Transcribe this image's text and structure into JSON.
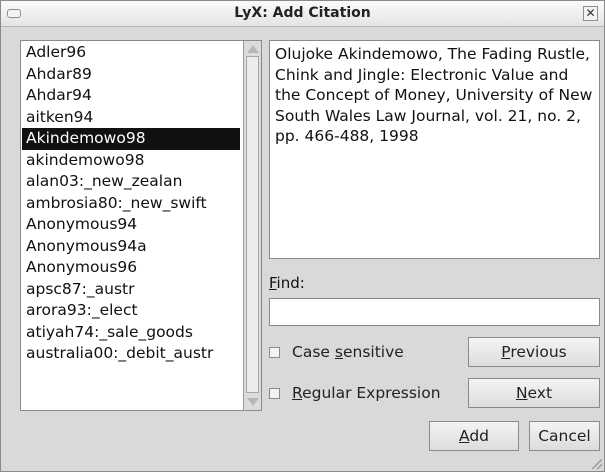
{
  "window": {
    "title": "LyX: Add Citation"
  },
  "keys": [
    "Adler96",
    "Ahdar89",
    "Ahdar94",
    "aitken94",
    "Akindemowo98",
    "akindemowo98",
    "alan03:_new_zealan",
    "ambrosia80:_new_swift",
    "Anonymous94",
    "Anonymous94a",
    "Anonymous96",
    "apsc87:_austr",
    "arora93:_elect",
    "atiyah74:_sale_goods",
    "australia00:_debit_austr"
  ],
  "selected_key": "Akindemowo98",
  "info_text": "Olujoke Akindemowo, The Fading Rustle, Chink and Jingle: Electronic Value and the Concept of Money, University of New South Wales Law Journal, vol. 21, no. 2, pp. 466-488, 1998",
  "find": {
    "label": "Find:",
    "value": ""
  },
  "options": {
    "case_sensitive": {
      "label": "Case sensitive",
      "checked": false
    },
    "regex": {
      "label": "Regular Expression",
      "checked": false
    }
  },
  "buttons": {
    "previous": "Previous",
    "next": "Next",
    "add": "Add",
    "cancel": "Cancel"
  }
}
